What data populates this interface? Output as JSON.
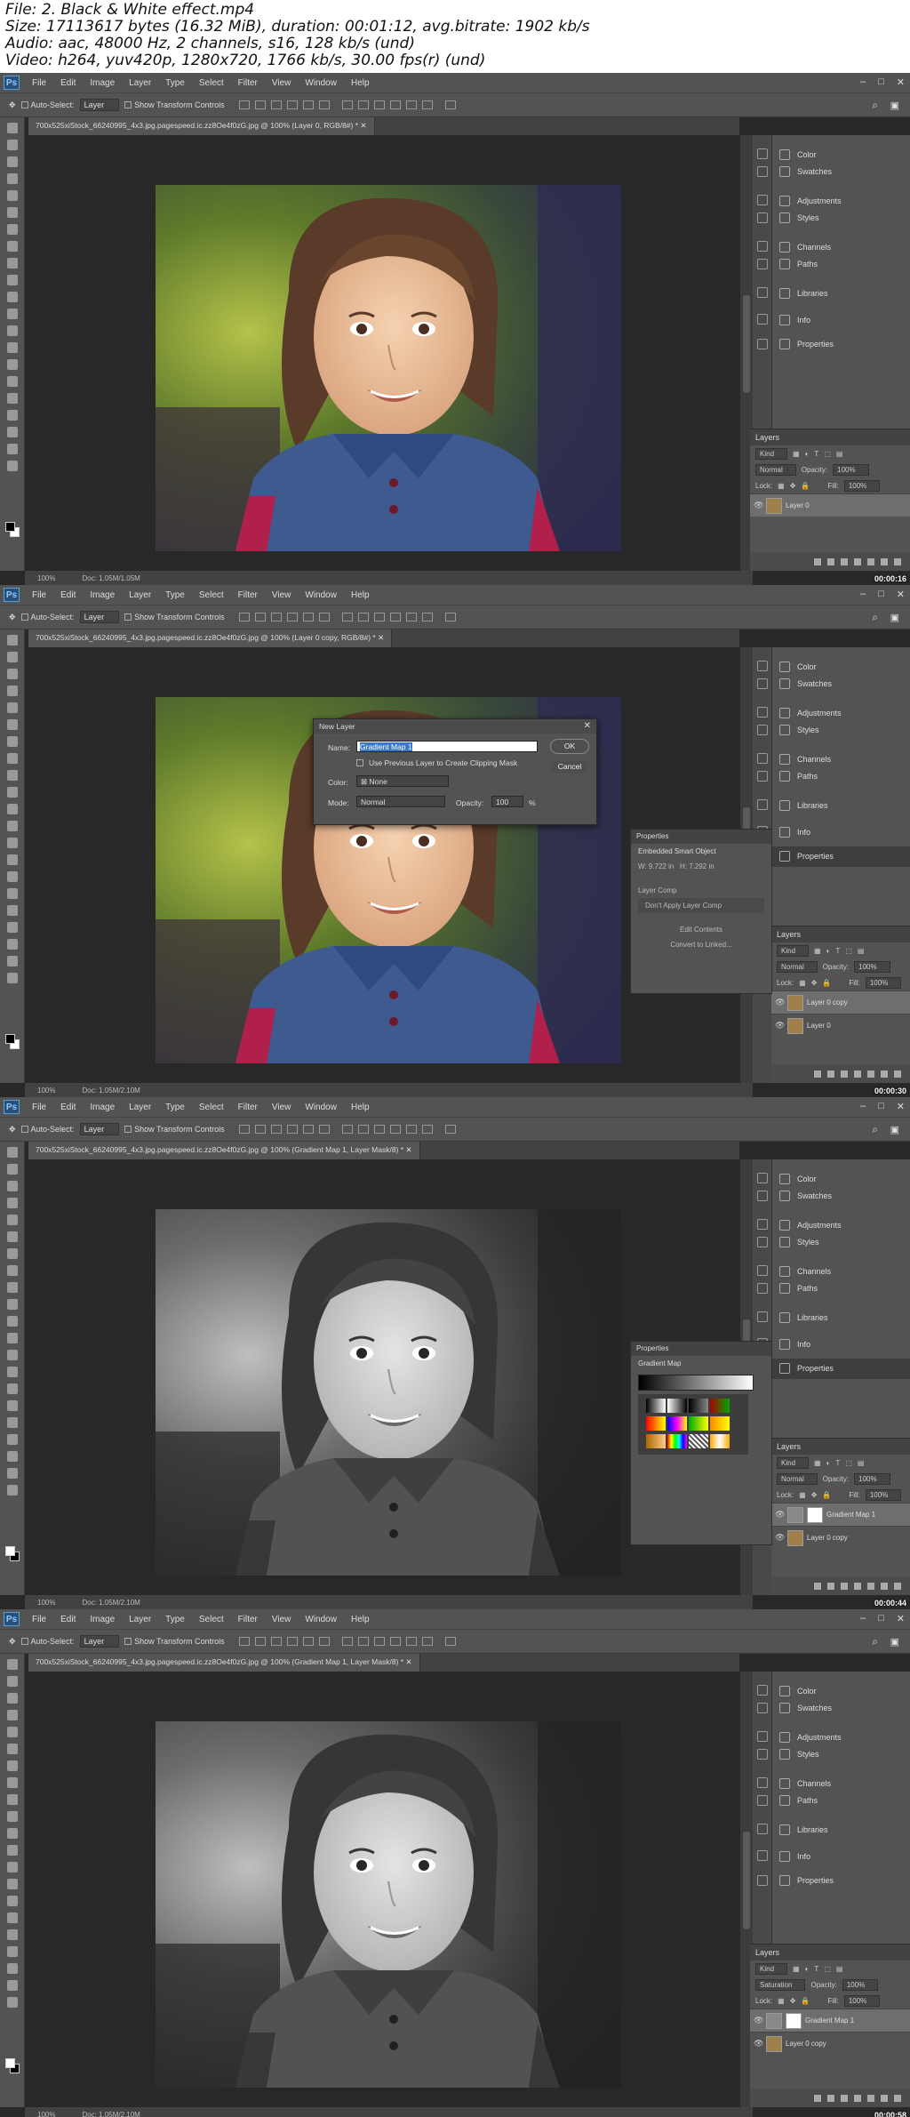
{
  "header": {
    "line1": "File: 2. Black & White effect.mp4",
    "line2": "Size: 17113617 bytes (16.32 MiB), duration: 00:01:12, avg.bitrate: 1902 kb/s",
    "line3": "Audio: aac, 48000 Hz, 2 channels, s16, 128 kb/s (und)",
    "line4": "Video: h264, yuv420p, 1280x720, 1766 kb/s, 30.00 fps(r) (und)"
  },
  "app": {
    "logo": "Ps",
    "menu": [
      "File",
      "Edit",
      "Image",
      "Layer",
      "Type",
      "Select",
      "Filter",
      "View",
      "Window",
      "Help"
    ],
    "options": {
      "auto_select": "Auto-Select:",
      "layer_select": "Layer",
      "transform": "Show Transform Controls"
    },
    "panels": [
      "Color",
      "Swatches",
      "Adjustments",
      "Styles",
      "Channels",
      "Paths",
      "Libraries",
      "Info",
      "Properties"
    ],
    "layers_tab": "Layers",
    "kind": "Kind",
    "opacity_label": "Opacity:",
    "opacity_val": "100%",
    "fill_label": "Fill:",
    "fill_val": "100%",
    "lock_label": "Lock:",
    "status_zoom": "100%",
    "status_doc": "Doc: 1.05M/1.05M",
    "status_doc2": "Doc: 1.05M/2.10M"
  },
  "frames": [
    {
      "tab": "700x525xiStock_66240995_4x3.jpg.pagespeed.ic.zz8Oe4f0zG.jpg @ 100% (Layer 0, RGB/8#) *",
      "blend": "Normal",
      "layers": [
        "Layer 0"
      ],
      "timecode": "00:00:16",
      "photo": "color"
    },
    {
      "tab": "700x525xiStock_66240995_4x3.jpg.pagespeed.ic.zz8Oe4f0zG.jpg @ 100% (Layer 0 copy, RGB/8#) *",
      "blend": "Normal",
      "layers": [
        "Layer 0 copy",
        "Layer 0"
      ],
      "timecode": "00:00:30",
      "photo": "color"
    },
    {
      "tab": "700x525xiStock_66240995_4x3.jpg.pagespeed.ic.zz8Oe4f0zG.jpg @ 100% (Gradient Map 1, Layer Mask/8) *",
      "blend": "Normal",
      "layers": [
        "Gradient Map 1",
        "Layer 0 copy"
      ],
      "timecode": "00:00:44",
      "photo": "bw"
    },
    {
      "tab": "700x525xiStock_66240995_4x3.jpg.pagespeed.ic.zz8Oe4f0zG.jpg @ 100% (Gradient Map 1, Layer Mask/8) *",
      "blend": "Saturation",
      "layers": [
        "Gradient Map 1",
        "Layer 0 copy"
      ],
      "timecode": "00:00:58",
      "photo": "bw"
    }
  ],
  "dialog": {
    "title": "New Layer",
    "name_label": "Name:",
    "name_value": "Gradient Map 1",
    "clip_label": "Use Previous Layer to Create Clipping Mask",
    "color_label": "Color:",
    "color_value": "None",
    "mode_label": "Mode:",
    "mode_value": "Normal",
    "opacity_label": "Opacity:",
    "opacity_value": "100",
    "pct": "%",
    "ok": "OK",
    "cancel": "Cancel"
  },
  "props_smart": {
    "tab": "Properties",
    "title": "Embedded Smart Object",
    "w": "W: 9.722 in",
    "h": "H: 7.292 in",
    "layer_comp": "Layer Comp",
    "dont_apply": "Don't Apply Layer Comp",
    "edit_contents": "Edit Contents",
    "convert": "Convert to Linked..."
  },
  "props_grad": {
    "tab": "Properties",
    "title": "Gradient Map"
  },
  "colors": {
    "bg": "#282828",
    "panel": "#535353",
    "selected_layer": "#6e6e6e",
    "highlight": "#3a78c9"
  }
}
